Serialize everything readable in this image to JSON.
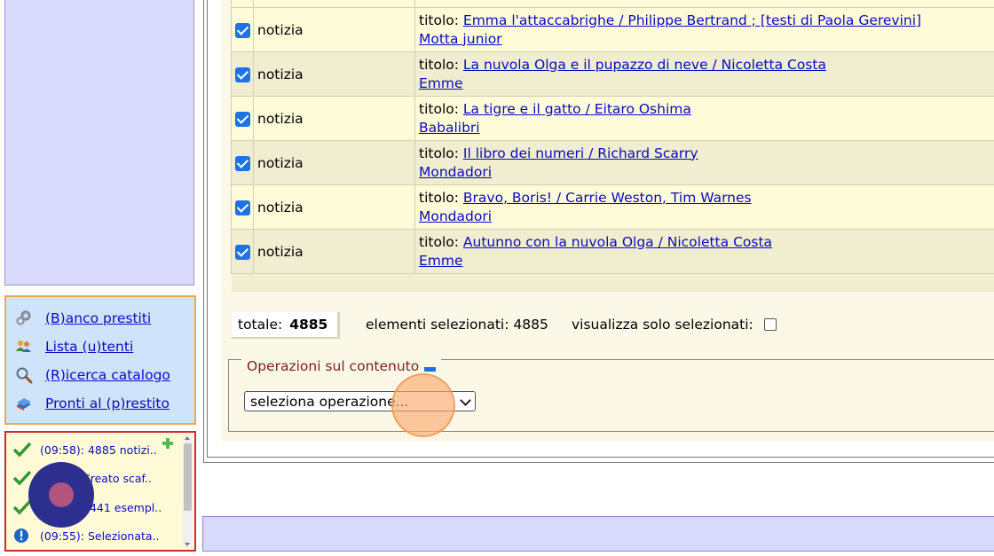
{
  "results": {
    "rows": [
      {
        "type": "notizia",
        "title_prefix": "titolo:",
        "title": "Emma l'attaccabrighe / Philippe Bertrand ; [testi di Paola Gerevini]",
        "publisher": "Motta junior"
      },
      {
        "type": "notizia",
        "title_prefix": "titolo:",
        "title": "La nuvola Olga e il pupazzo di neve / Nicoletta Costa",
        "publisher": "Emme"
      },
      {
        "type": "notizia",
        "title_prefix": "titolo:",
        "title": "La tigre e il gatto / Eitaro Oshima",
        "publisher": "Babalibri"
      },
      {
        "type": "notizia",
        "title_prefix": "titolo:",
        "title": "Il libro dei numeri / Richard Scarry",
        "publisher": "Mondadori"
      },
      {
        "type": "notizia",
        "title_prefix": "titolo:",
        "title": "Bravo, Boris! / Carrie Weston, Tim Warnes",
        "publisher": "Mondadori"
      },
      {
        "type": "notizia",
        "title_prefix": "titolo:",
        "title": "Autunno con la nuvola Olga / Nicoletta Costa",
        "publisher": "Emme"
      }
    ]
  },
  "summary": {
    "totale_label": "totale:",
    "totale_value": "4885",
    "selected_text": "elementi selezionati:  4885",
    "show_selected_label": "visualizza solo selezionati:"
  },
  "operations": {
    "legend": "Operazioni sul contenuto",
    "select_value": "seleziona operazione..."
  },
  "nav": {
    "items": [
      {
        "label": "(B)anco prestiti",
        "icon": "gears-icon"
      },
      {
        "label": "Lista (u)tenti",
        "icon": "users-icon"
      },
      {
        "label": "(R)icerca catalogo",
        "icon": "magnifier-icon"
      },
      {
        "label": "Pronti al (p)restito",
        "icon": "books-icon"
      }
    ]
  },
  "log": {
    "items": [
      {
        "text": "(09:58): 4885 notizi..",
        "icon": "check-icon"
      },
      {
        "text": "Creato scaf..",
        "icon": "check-icon"
      },
      {
        "text": "5441 esempl..",
        "icon": "check-icon"
      },
      {
        "text": "(09:55): Selezionata..",
        "icon": "info-icon"
      }
    ]
  },
  "colors": {
    "left_panel": "#d9d9fb",
    "nav_bg": "#cfe3fb",
    "nav_border": "#f0a94b",
    "log_bg": "#fffbd6",
    "log_border": "#d12a2a",
    "content_bg": "#fbf8e8",
    "checkbox": "#1a73e8",
    "link": "#0b0bbf"
  }
}
